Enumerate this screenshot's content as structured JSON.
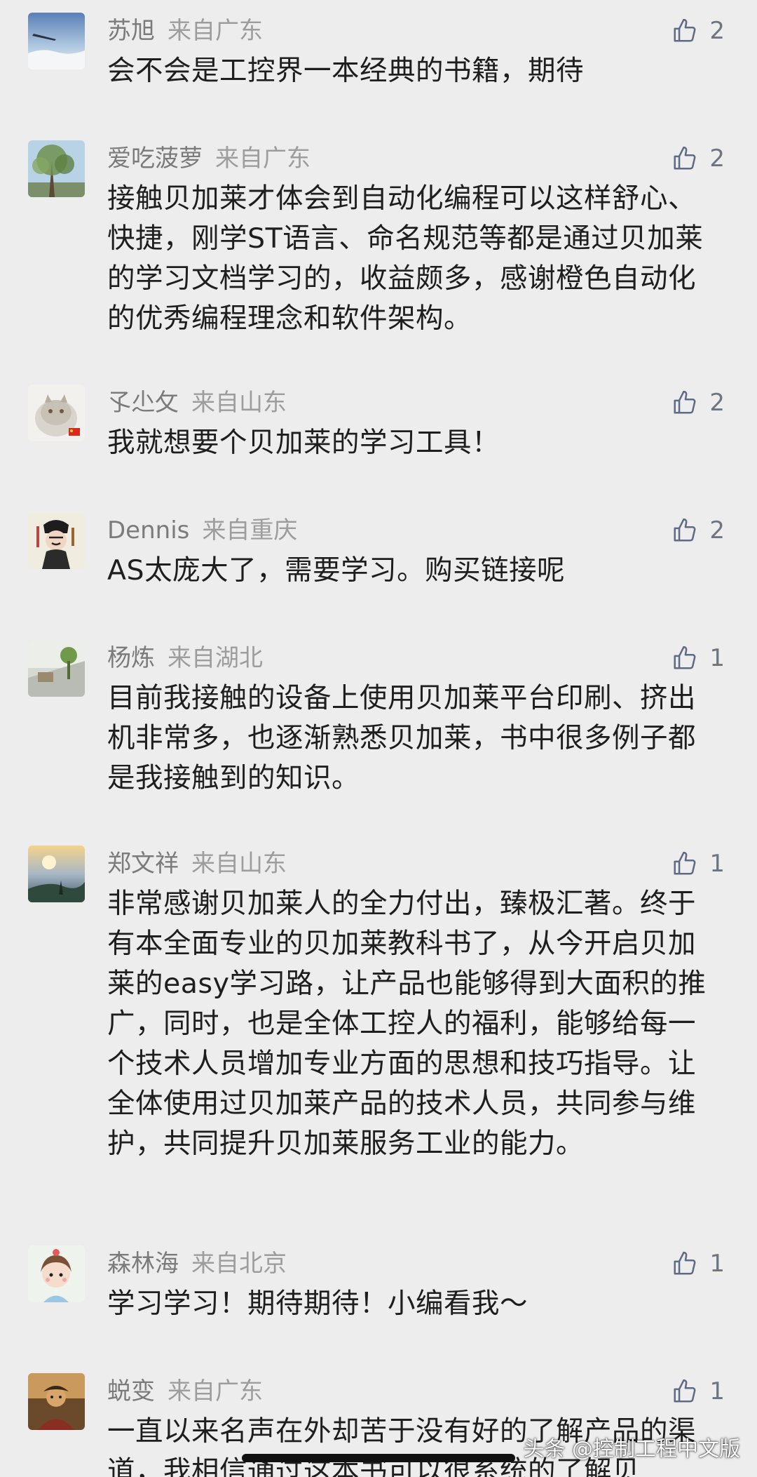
{
  "comments": [
    {
      "username": "苏旭",
      "location": "来自广东",
      "likes": "2",
      "text": "会不会是工控界一本经典的书籍，期待"
    },
    {
      "username": "爱吃菠萝",
      "location": "来自广东",
      "likes": "2",
      "text": "接触贝加莱才体会到自动化编程可以这样舒心、快捷，刚学ST语言、命名规范等都是通过贝加莱的学习文档学习的，收益颇多，感谢橙色自动化的优秀编程理念和软件架构。"
    },
    {
      "username": "孓尐攵",
      "location": "来自山东",
      "likes": "2",
      "text": "我就想要个贝加莱的学习工具！"
    },
    {
      "username": "Dennis",
      "location": "来自重庆",
      "likes": "2",
      "text": "AS太庞大了，需要学习。购买链接呢"
    },
    {
      "username": "杨炼",
      "location": "来自湖北",
      "likes": "1",
      "text": "目前我接触的设备上使用贝加莱平台印刷、挤出机非常多，也逐渐熟悉贝加莱，书中很多例子都是我接触到的知识。"
    },
    {
      "username": "郑文祥",
      "location": "来自山东",
      "likes": "1",
      "text": "非常感谢贝加莱人的全力付出，臻极汇著。终于有本全面专业的贝加莱教科书了，从今开启贝加莱的easy学习路，让产品也能够得到大面积的推广，同时，也是全体工控人的福利，能够给每一个技术人员增加专业方面的思想和技巧指导。让全体使用过贝加莱产品的技术人员，共同参与维护，共同提升贝加莱服务工业的能力。"
    },
    {
      "username": "森林海",
      "location": "来自北京",
      "likes": "1",
      "text": "学习学习！期待期待！小编看我～"
    },
    {
      "username": "蜕变",
      "location": "来自广东",
      "likes": "1",
      "text": "一直以来名声在外却苦于没有好的了解产品的渠道，我相信通过这本书可以很系统的了解贝"
    }
  ],
  "watermark": "头条 @控制工程中文版",
  "colors": {
    "background": "#ededed",
    "username": "#7b7b7b",
    "location": "#9d9d9d",
    "like": "#5f6b85",
    "text": "#1e1e1e"
  },
  "icons": {
    "like": "thumbs-up-icon",
    "avatar": "avatar-photo"
  }
}
